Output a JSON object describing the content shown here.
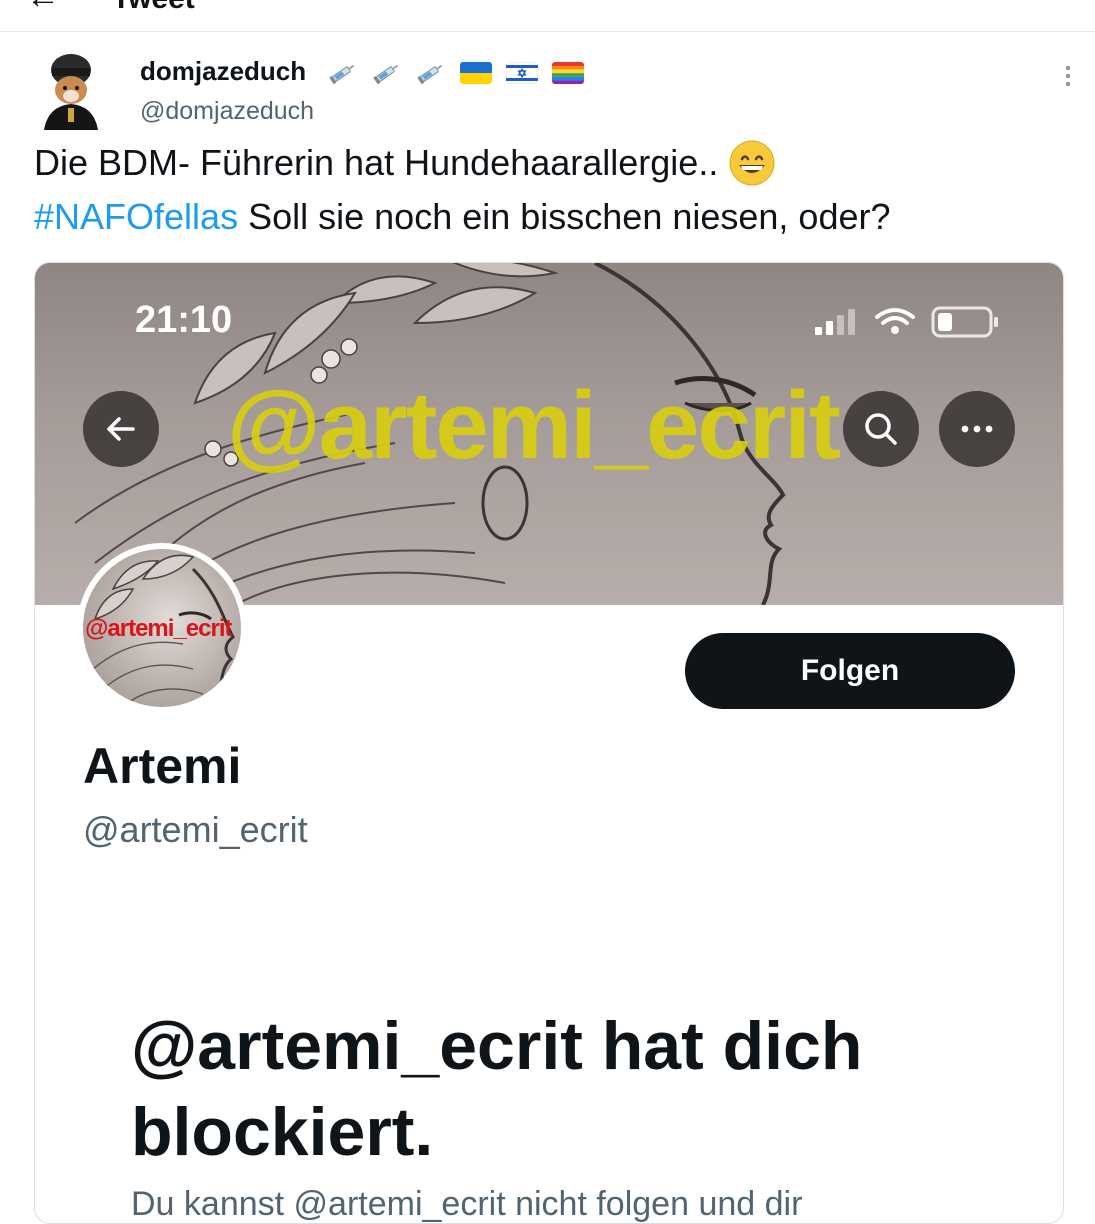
{
  "topbar": {
    "back_glyph": "←",
    "title": "Tweet"
  },
  "tweet": {
    "author": {
      "display_name": "domjazeduch",
      "handle": "@domjazeduch",
      "name_emojis": [
        "syringe-icon",
        "syringe-icon",
        "syringe-icon",
        "ukraine-flag-icon",
        "israel-flag-icon",
        "rainbow-flag-icon"
      ]
    },
    "more_icon": "more-vertical-icon",
    "text_line1": "Die BDM- Führerin hat Hundehaarallergie..",
    "text_emoji": "grinning-face-icon",
    "hashtag": "#NAFOfellas",
    "text_line2_rest": "Soll sie noch ein bisschen niesen, oder?"
  },
  "embedded": {
    "status_time": "21:10",
    "banner_watermark": "@artemi_ecrit",
    "avatar_watermark": "@artemi_ecrit",
    "follow_label": "Folgen",
    "profile_name": "Artemi",
    "profile_handle": "@artemi_ecrit",
    "blocked_title": "@artemi_ecrit hat dich blockiert.",
    "blocked_sub": "Du kannst @artemi_ecrit nicht folgen und dir"
  },
  "colors": {
    "text": "#0f1419",
    "muted": "#536471",
    "link": "#1d9bf0",
    "button": "#0f1419"
  }
}
